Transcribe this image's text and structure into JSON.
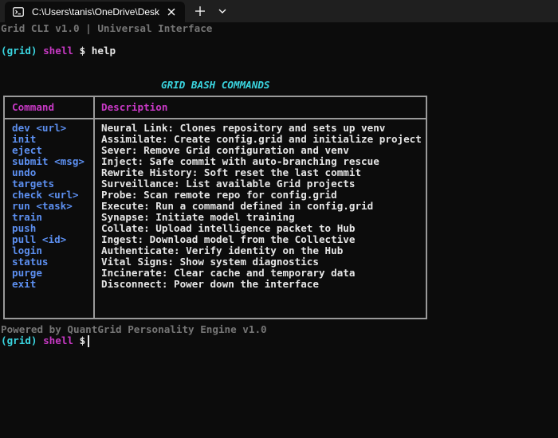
{
  "window": {
    "tab_title": "C:\\Users\\tanis\\OneDrive\\Desk",
    "tab_icon": "terminal-icon",
    "new_tab_icon": "plus-icon",
    "dropdown_icon": "chevron-down-icon",
    "close_icon": "close-icon"
  },
  "terminal": {
    "banner": "Grid CLI v1.0 | Universal Interface",
    "prompt": {
      "context": "(grid)",
      "shell": "shell",
      "symbol": "$",
      "command": "help"
    },
    "table_title": "GRID BASH COMMANDS",
    "table": {
      "headers": [
        "Command",
        "Description"
      ],
      "rows": [
        {
          "command": "dev <url>",
          "description": "Neural Link: Clones repository and sets up venv"
        },
        {
          "command": "init",
          "description": "Assimilate: Create config.grid and initialize project"
        },
        {
          "command": "eject",
          "description": "Sever: Remove Grid configuration and venv"
        },
        {
          "command": "submit <msg>",
          "description": "Inject: Safe commit with auto-branching rescue"
        },
        {
          "command": "undo",
          "description": "Rewrite History: Soft reset the last commit"
        },
        {
          "command": "targets",
          "description": "Surveillance: List available Grid projects"
        },
        {
          "command": "check <url>",
          "description": "Probe: Scan remote repo for config.grid"
        },
        {
          "command": "run <task>",
          "description": "Execute: Run a command defined in config.grid"
        },
        {
          "command": "train",
          "description": "Synapse: Initiate model training"
        },
        {
          "command": "push",
          "description": "Collate: Upload intelligence packet to Hub"
        },
        {
          "command": "pull <id>",
          "description": "Ingest: Download model from the Collective"
        },
        {
          "command": "login",
          "description": "Authenticate: Verify identity on the Hub"
        },
        {
          "command": "status",
          "description": "Vital Signs: Show system diagnostics"
        },
        {
          "command": "purge",
          "description": "Incinerate: Clear cache and temporary data"
        },
        {
          "command": "exit",
          "description": "Disconnect: Power down the interface"
        }
      ]
    },
    "footer": "Powered by QuantGrid Personality Engine v1.0",
    "prompt2": {
      "context": "(grid)",
      "shell": "shell",
      "symbol": "$"
    }
  },
  "colors": {
    "background": "#0c0c0c",
    "titlebar": "#1f1f1f",
    "prompt_context": "#3ad5e0",
    "prompt_shell": "#c839c5",
    "command_names": "#5c8ff0",
    "header_text": "#c839c5",
    "dim_text": "#767676",
    "border": "#9a9a9a"
  }
}
